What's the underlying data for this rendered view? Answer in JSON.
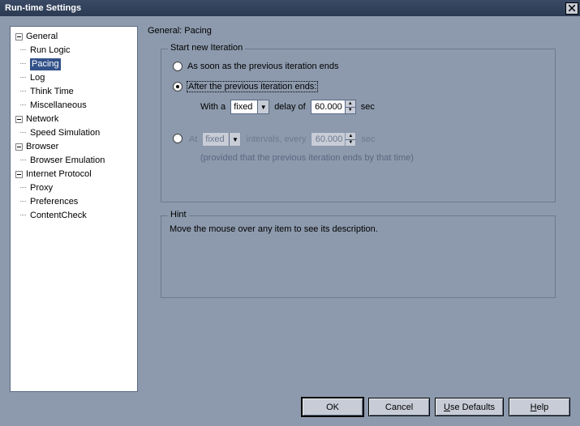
{
  "window": {
    "title": "Run-time Settings"
  },
  "tree": {
    "general": {
      "label": "General",
      "run_logic": "Run Logic",
      "pacing": "Pacing",
      "log": "Log",
      "think_time": "Think Time",
      "miscellaneous": "Miscellaneous"
    },
    "network": {
      "label": "Network",
      "speed_simulation": "Speed Simulation"
    },
    "browser": {
      "label": "Browser",
      "browser_emulation": "Browser Emulation"
    },
    "internet_protocol": {
      "label": "Internet Protocol",
      "proxy": "Proxy",
      "preferences": "Preferences",
      "content_check": "ContentCheck"
    }
  },
  "content": {
    "heading": "General: Pacing",
    "group_iter_label": "Start new Iteration",
    "opt1": "As soon as the previous iteration ends",
    "opt2": "After the previous iteration ends:",
    "opt2_with_a": "With a",
    "opt2_delay_type": "fixed",
    "opt2_delay_of": "delay of",
    "opt2_delay_value": "60.000",
    "opt2_sec": "sec",
    "opt3_at": "At",
    "opt3_type": "fixed",
    "opt3_intervals": "intervals, every",
    "opt3_value": "60.000",
    "opt3_sec": "sec",
    "opt3_note": "(provided that the previous iteration ends by that time)",
    "hint_label": "Hint",
    "hint_text": "Move the mouse over any item to see its description."
  },
  "buttons": {
    "ok": "OK",
    "cancel": "Cancel",
    "use_defaults": "Use Defaults",
    "help": "Help"
  }
}
